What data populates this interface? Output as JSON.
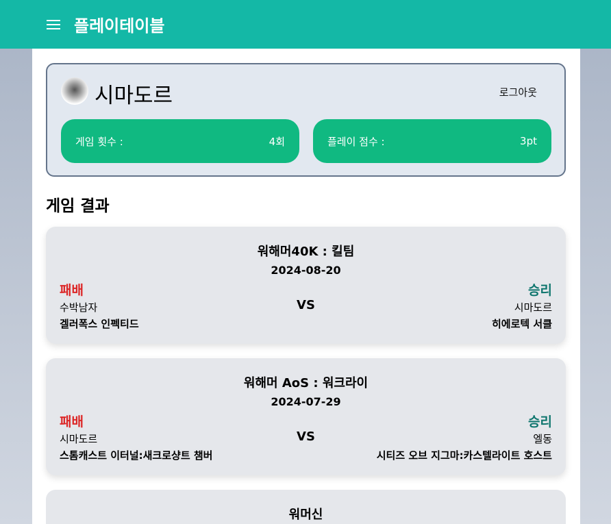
{
  "header": {
    "title": "플레이테이블",
    "menu_icon": "hamburger-icon"
  },
  "profile": {
    "name": "시마도르",
    "logout": "로그아웃",
    "stats": [
      {
        "label": "게임 횟수 :",
        "value": "4회"
      },
      {
        "label": "플레이 점수 :",
        "value": "3pt"
      }
    ]
  },
  "section_title": "게임 결과",
  "results": [
    {
      "game": "워해머40K : 킬팀",
      "date": "2024-08-20",
      "left_result": "패배",
      "right_result": "승리",
      "left_player": "수박남자",
      "right_player": "시마도르",
      "vs": "VS",
      "left_faction": "겔러폭스 인펙티드",
      "right_faction": "히에로텍 서클"
    },
    {
      "game": "워해머 AoS : 워크라이",
      "date": "2024-07-29",
      "left_result": "패배",
      "right_result": "승리",
      "left_player": "시마도르",
      "right_player": "엘동",
      "vs": "VS",
      "left_faction": "스톰캐스트 이터널:새크로샹트 챔버",
      "right_faction": "시티즈 오브 지그마:카스텔라이트 호스트"
    },
    {
      "game": "워머신"
    }
  ],
  "colors": {
    "header": "#14b8a6",
    "stat": "#10b981",
    "loss": "#dc2626",
    "win": "#0f766e"
  }
}
